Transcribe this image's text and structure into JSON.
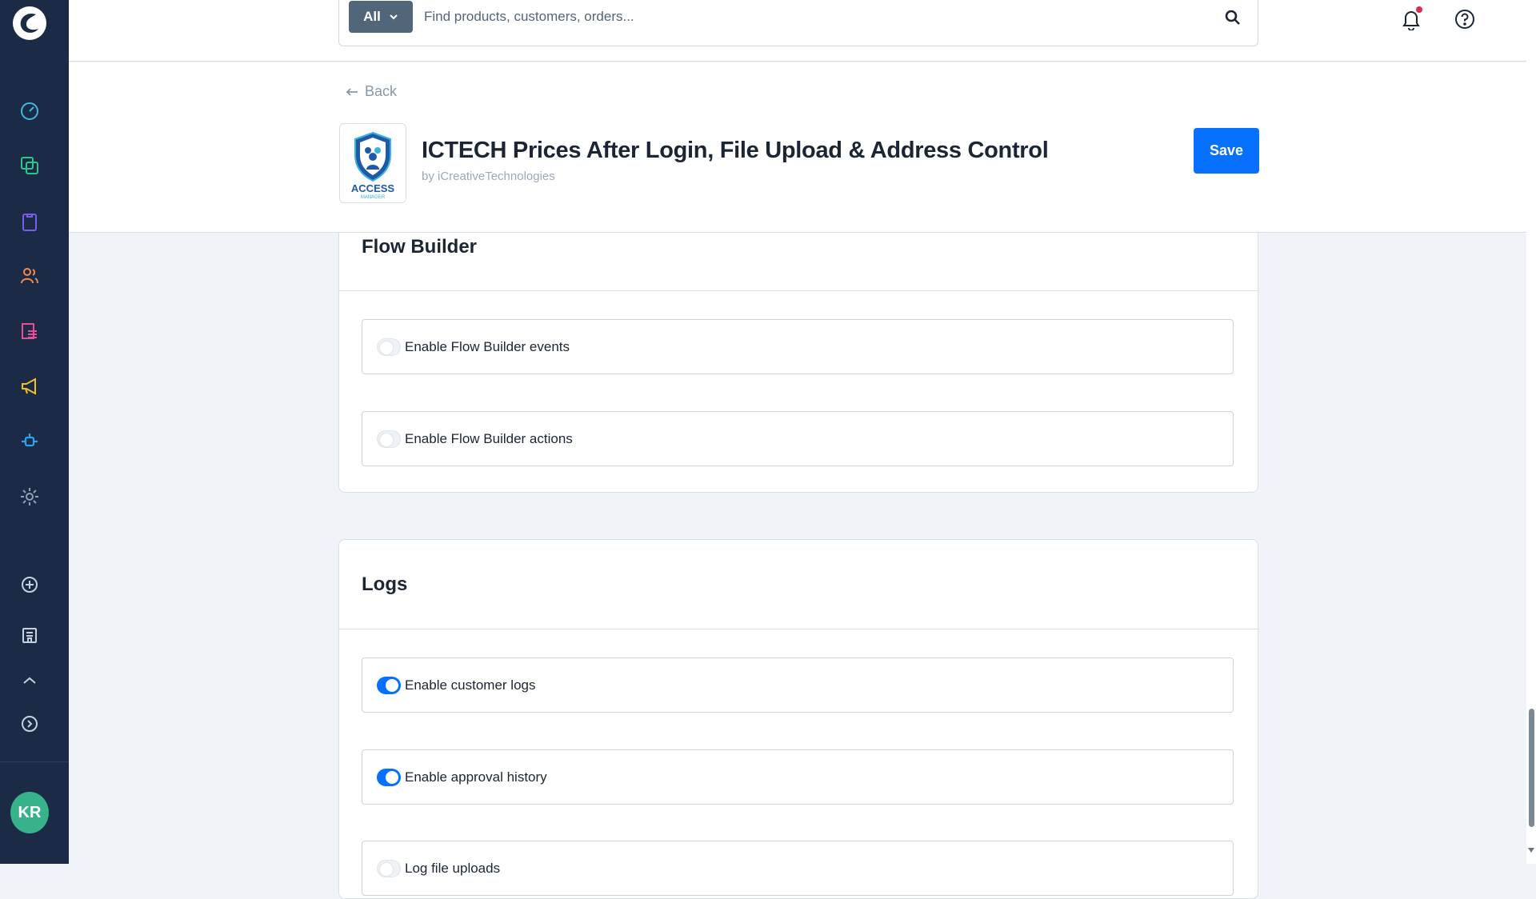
{
  "search": {
    "type_label": "All",
    "placeholder": "Find products, customers, orders..."
  },
  "sidebar": {
    "items": [
      {
        "icon": "dashboard-gauge-icon",
        "color": "#3fb8de"
      },
      {
        "icon": "catalog-copy-icon",
        "color": "#33c48c"
      },
      {
        "icon": "orders-clipboard-icon",
        "color": "#7a5cf2"
      },
      {
        "icon": "customers-users-icon",
        "color": "#f28a4a"
      },
      {
        "icon": "content-list-icon",
        "color": "#e84d9a"
      },
      {
        "icon": "marketing-megaphone-icon",
        "color": "#f2c029"
      },
      {
        "icon": "extensions-plug-icon",
        "color": "#2ea3e8"
      },
      {
        "icon": "settings-gear-icon",
        "color": "#8fa1b7"
      },
      {
        "icon": "add-circle-icon",
        "color": "#c6d1de"
      },
      {
        "icon": "sales-channel-store-icon",
        "color": "#c6d1de"
      },
      {
        "icon": "collapse-arrow-icon",
        "color": "#c6d1de"
      }
    ],
    "avatar_initials": "KR"
  },
  "header": {
    "back_label": "Back",
    "app_title": "ICTECH Prices After Login, File Upload & Address Control",
    "app_vendor": "by iCreativeTechnologies",
    "save_label": "Save",
    "logo_text": "ACCESS",
    "logo_subtext": "MANAGER"
  },
  "flow_builder": {
    "title": "Flow Builder",
    "options": [
      {
        "label": "Enable Flow Builder events",
        "enabled": false
      },
      {
        "label": "Enable Flow Builder actions",
        "enabled": false
      }
    ]
  },
  "logs": {
    "title": "Logs",
    "options": [
      {
        "label": "Enable customer logs",
        "enabled": true
      },
      {
        "label": "Enable approval history",
        "enabled": true
      },
      {
        "label": "Log file uploads",
        "enabled": false
      }
    ]
  },
  "colors": {
    "accent": "#0870ff",
    "sidebar_bg": "#1b2a45",
    "notification_dot": "#de294c",
    "avatar_bg": "#37b28a"
  }
}
